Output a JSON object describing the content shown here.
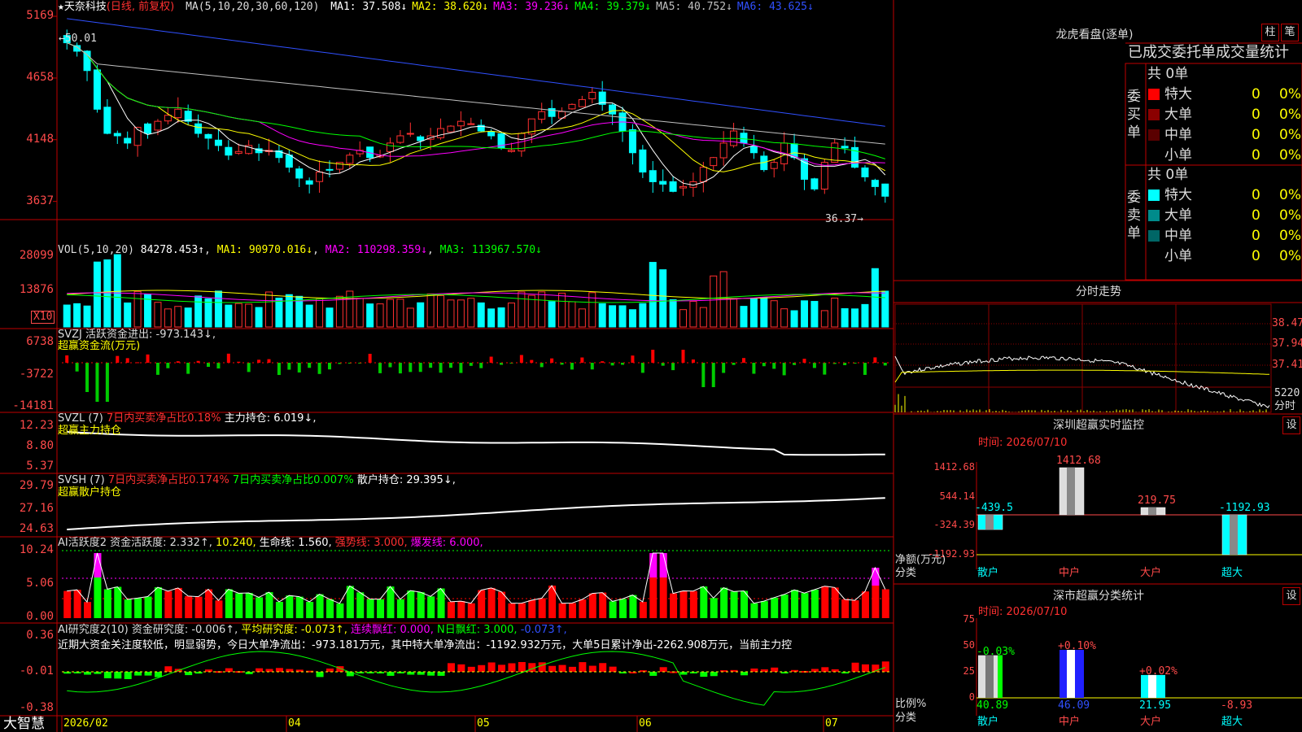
{
  "window": {
    "app_name": "大智慧"
  },
  "kline": {
    "header": {
      "star": "★",
      "stock": "天奈科技",
      "mode": "(日线, 前复权)",
      "ma_label": "MA(5,10,20,30,60,120)",
      "ma": [
        {
          "name": "MA1",
          "value": "37.508↓",
          "color": "#ffffff"
        },
        {
          "name": "MA2",
          "value": "38.620↓",
          "color": "#ffff00"
        },
        {
          "name": "MA3",
          "value": "39.236↓",
          "color": "#ff00ff"
        },
        {
          "name": "MA4",
          "value": "39.379↓",
          "color": "#00ff00"
        },
        {
          "name": "MA5",
          "value": "40.752↓",
          "color": "#c0c0c0"
        },
        {
          "name": "MA6",
          "value": "43.625↓",
          "color": "#3050ff"
        }
      ]
    },
    "y_ticks": [
      "5169",
      "4658",
      "4148",
      "3637"
    ],
    "high_label": "←50.01",
    "low_label": "36.37→"
  },
  "vol": {
    "header": "VOL(5,10,20)",
    "value": "84278.453↑",
    "ma1": "MA1: 90970.016↓",
    "ma2": "MA2: 110298.359↓",
    "ma3": "MA3: 113967.570↓",
    "y_ticks": [
      "28099",
      "13876"
    ],
    "unit": "X10"
  },
  "svzj": {
    "header": "SVZJ  活跃资金进出: -973.143↓,",
    "sub": "超赢资金流(万元)",
    "y_ticks": [
      "6738",
      "-3722",
      "-14181"
    ]
  },
  "svzl": {
    "header": "SVZL (7) ",
    "h2": "7日内买卖净占比0.18%",
    "h3": " 主力持仓: 6.019↓,",
    "sub": "超赢主力持仓",
    "y_ticks": [
      "12.23",
      "8.80",
      "5.37"
    ]
  },
  "svsh": {
    "header": "SVSH (7) ",
    "h2": "7日内买卖净占比0.174%",
    "h3": " 7日内买卖净占比0.007%",
    "h4": " 散户持仓: 29.395↓,",
    "sub": "超赢散户持仓",
    "y_ticks": [
      "29.79",
      "27.16",
      "24.63"
    ]
  },
  "ai_active": {
    "header": "AI活跃度2 资金活跃度: 2.332↑,",
    "v2": " 10.240,",
    "v3": " 生命线: 1.560,",
    "v4": " 强势线: 3.000,",
    "v5": " 爆发线: 6.000,",
    "y_ticks": [
      "10.24",
      "5.06",
      "0.00"
    ]
  },
  "ai_research": {
    "header": "AI研究度2(10) 资金研究度: -0.006↑,",
    "v2": " 平均研究度: -0.073↑,",
    "v3": " 连续飘红: 0.000,",
    "v4": " N日飘红: 3.000,",
    "v5": " -0.073↑,",
    "text": "近期大资金关注度较低，明显弱势，今日大单净流出：-973.181万元，其中特大单净流出：-1192.932万元，大单5日累计净出-2262.908万元，当前主力控",
    "y_ticks": [
      "0.36",
      "-0.01",
      "-0.38"
    ]
  },
  "x_axis": {
    "labels": [
      "2026/02",
      "04",
      "05",
      "06",
      "07"
    ]
  },
  "right": {
    "dragon_title": "龙虎看盘(逐单)",
    "btn1": "柱",
    "btn2": "笔",
    "stat_title": "已成交委托单成交量统计",
    "buy_side": {
      "label": "委买单",
      "total": "共 0单",
      "rows": [
        {
          "name": "特大",
          "count": "0",
          "pct": "0%",
          "color": "#ff0000"
        },
        {
          "name": "大单",
          "count": "0",
          "pct": "0%",
          "color": "#8b0000"
        },
        {
          "name": "中单",
          "count": "0",
          "pct": "0%",
          "color": "#5a0000"
        },
        {
          "name": "小单",
          "count": "0",
          "pct": "0%",
          "color": "#000000"
        }
      ]
    },
    "sell_side": {
      "label": "委卖单",
      "total": "共 0单",
      "rows": [
        {
          "name": "特大",
          "count": "0",
          "pct": "0%",
          "color": "#00ffff"
        },
        {
          "name": "大单",
          "count": "0",
          "pct": "0%",
          "color": "#008b8b"
        },
        {
          "name": "中单",
          "count": "0",
          "pct": "0%",
          "color": "#006666"
        },
        {
          "name": "小单",
          "count": "0",
          "pct": "0%",
          "color": "#000000"
        }
      ]
    },
    "intraday": {
      "title": "分时走势",
      "y_ticks": [
        "38.47",
        "37.94",
        "37.41"
      ],
      "vol_label": "5220",
      "sub_label": "分时"
    },
    "monitor": {
      "title": "深圳超赢实时监控",
      "btn": "设",
      "time": "时间: 2026/07/10",
      "y_ticks": [
        "1412.68",
        "544.14",
        "-324.39",
        "-1192.93"
      ],
      "side_label1": "净额(万元)",
      "side_label2": "分类"
    },
    "class_stat": {
      "title": "深市超赢分类统计",
      "btn": "设",
      "time": "时间: 2026/07/10",
      "y_ticks": [
        "75",
        "50",
        "25",
        "0"
      ],
      "side_label1": "比例%",
      "side_label2": "分类"
    }
  },
  "chart_data": [
    {
      "type": "candlestick",
      "title": "天奈科技 (日线, 前复权)",
      "x_range": [
        "2026/02",
        "2026/07/10"
      ],
      "ylim": [
        35.0,
        52.5
      ],
      "annotations": {
        "high": 50.01,
        "low": 36.37
      },
      "ohlc_close_approx": [
        49.5,
        48.8,
        47.2,
        44.0,
        42.0,
        41.8,
        41.2,
        42.5,
        42.0,
        43.0,
        43.5,
        44.0,
        43.0,
        42.0,
        41.6,
        41.0,
        40.2,
        40.5,
        41.0,
        40.4,
        40.6,
        40.0,
        39.2,
        38.3,
        37.8,
        38.8,
        39.0,
        39.6,
        40.2,
        40.6,
        40.0,
        40.2,
        41.2,
        41.8,
        42.0,
        41.4,
        41.8,
        42.4,
        42.6,
        43.0,
        42.8,
        42.2,
        41.8,
        40.8,
        40.6,
        42.0,
        43.2,
        43.8,
        43.4,
        43.8,
        44.4,
        44.8,
        45.4,
        44.4,
        43.6,
        42.2,
        40.4,
        38.8,
        38.0,
        37.8,
        37.2,
        37.6,
        38.0,
        39.2,
        40.0,
        41.2,
        42.2,
        41.2,
        40.4,
        39.0,
        39.6,
        41.2,
        40.0,
        38.2,
        37.4,
        39.6,
        41.2,
        40.8,
        39.2,
        38.4,
        37.6,
        36.8
      ]
    },
    {
      "type": "bar",
      "title": "VOL(5,10,20)",
      "values": [
        84278.453
      ],
      "series": [
        {
          "name": "MA1",
          "values": [
            90970.016
          ]
        },
        {
          "name": "MA2",
          "values": [
            110298.359
          ]
        },
        {
          "name": "MA3",
          "values": [
            113967.57
          ]
        }
      ],
      "ylim": [
        0,
        28099
      ]
    },
    {
      "type": "bar",
      "title": "中户 / 散户 / 大户 / 超大 净额(万元)",
      "categories": [
        "散户",
        "中户",
        "大户",
        "超大"
      ],
      "values": [
        -439.5,
        1412.68,
        219.75,
        -1192.93
      ],
      "ylim": [
        -1192.93,
        1412.68
      ]
    },
    {
      "type": "bar",
      "title": "深市超赢分类统计 比例%",
      "categories": [
        "散户",
        "中户",
        "大户",
        "超大"
      ],
      "values": [
        40.89,
        46.09,
        21.95,
        -8.93
      ],
      "deltas": [
        "-0.03%",
        "+0.10%",
        "+0.02%",
        ""
      ],
      "ylim": [
        0,
        75
      ]
    }
  ]
}
